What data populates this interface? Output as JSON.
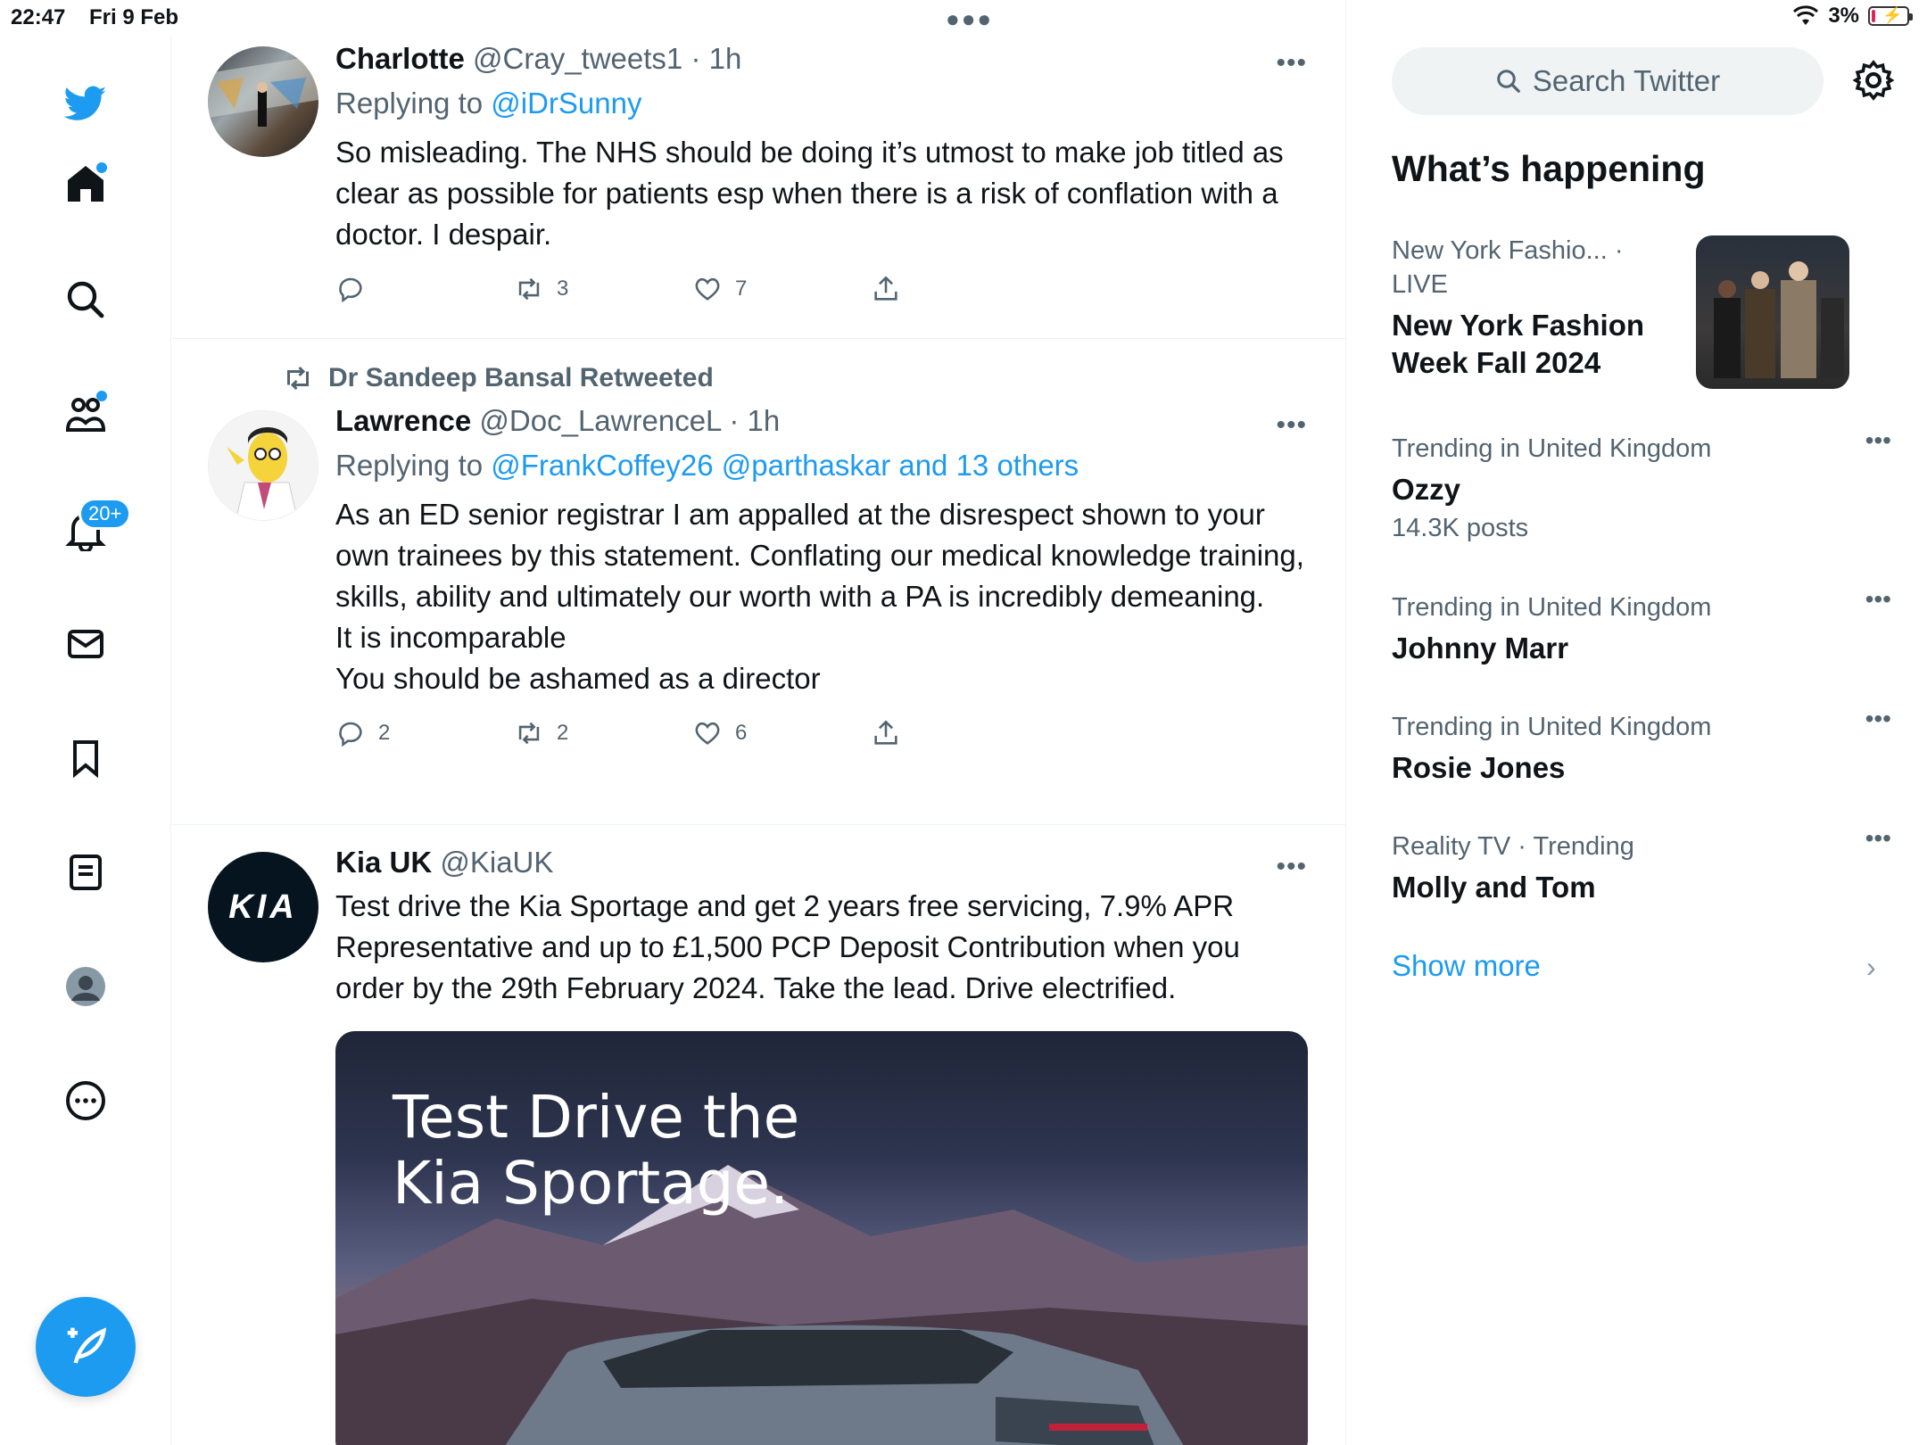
{
  "status": {
    "time": "22:47",
    "date": "Fri 9 Feb",
    "battery": "3%"
  },
  "nav": {
    "notifications_badge": "20+"
  },
  "tweets": [
    {
      "name": "Charlotte",
      "handle": "@Cray_tweets1",
      "time": "· 1h",
      "replying_prefix": "Replying to ",
      "replying_to": "@iDrSunny",
      "text": "So misleading. The NHS should be doing it’s utmost to make job titled as clear as possible for patients esp when there is a risk of conflation with a doctor. I despair.",
      "replies": "",
      "retweets": "3",
      "likes": "7"
    },
    {
      "retweeted_by": "Dr Sandeep Bansal Retweeted",
      "name": "Lawrence",
      "handle": "@Doc_LawrenceL",
      "time": "· 1h",
      "replying_prefix": "Replying to ",
      "replying_to": "@FrankCoffey26 @parthaskar and 13 others",
      "text_lines": [
        "As an ED senior registrar I am appalled at the disrespect shown to your own trainees by this statement. Conflating our medical knowledge training, skills, ability and ultimately our worth with a PA is incredibly demeaning.",
        "It is incomparable",
        "You should be ashamed as a director"
      ],
      "replies": "2",
      "retweets": "2",
      "likes": "6"
    },
    {
      "name": "Kia UK",
      "handle": "@KiaUK",
      "text": "Test drive the Kia Sportage and get 2 years free servicing, 7.9% APR Representative and up to £1,500 PCP Deposit Contribution when you order by the 29th February 2024. Take the lead. Drive electrified.",
      "image_text_1": "Test Drive the",
      "image_text_2": "Kia Sportage.",
      "avatar_logo": "KIA"
    }
  ],
  "sidebar": {
    "search_placeholder": "Search Twitter",
    "title": "What’s happening",
    "trends": [
      {
        "meta": "New York Fashio...",
        "live": "· LIVE",
        "name": "New York Fashion Week Fall 2024"
      },
      {
        "meta": "Trending in United Kingdom",
        "name": "Ozzy",
        "count": "14.3K posts"
      },
      {
        "meta": "Trending in United Kingdom",
        "name": "Johnny Marr"
      },
      {
        "meta": "Trending in United Kingdom",
        "name": "Rosie Jones"
      },
      {
        "meta": "Reality TV · Trending",
        "name": "Molly and Tom"
      }
    ],
    "show_more": "Show more"
  }
}
